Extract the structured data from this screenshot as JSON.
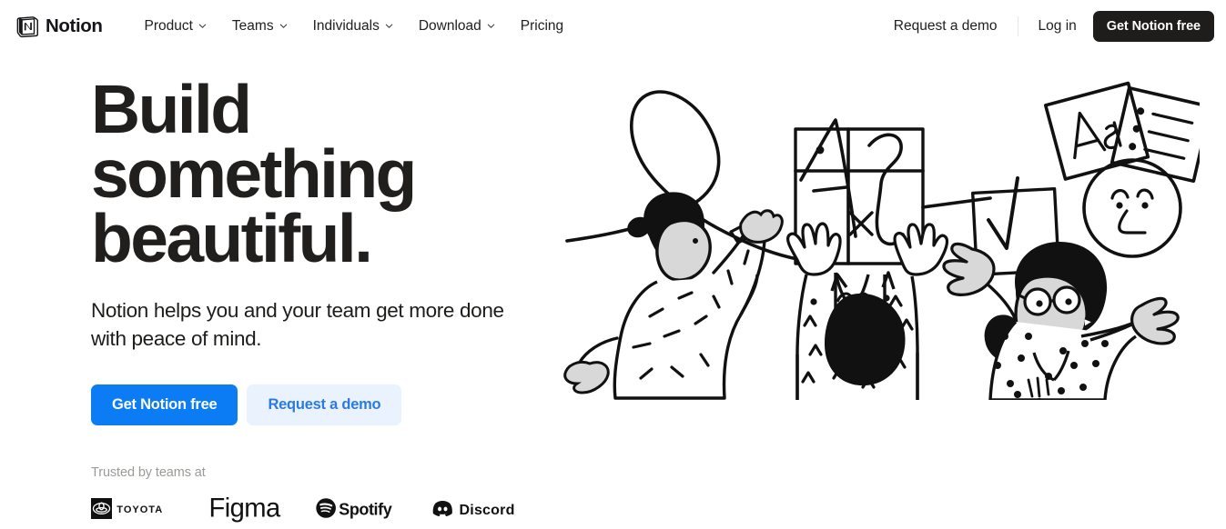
{
  "nav": {
    "brand": {
      "name": "Notion",
      "icon": "notion-logo-icon"
    },
    "links": [
      {
        "label": "Product",
        "has_chevron": true
      },
      {
        "label": "Teams",
        "has_chevron": true
      },
      {
        "label": "Individuals",
        "has_chevron": true
      },
      {
        "label": "Download",
        "has_chevron": true
      },
      {
        "label": "Pricing",
        "has_chevron": false
      }
    ],
    "request_demo": "Request a demo",
    "login": "Log in",
    "cta": "Get Notion free"
  },
  "hero": {
    "title_lines": [
      "Build",
      "something",
      "beautiful."
    ],
    "title_full": "Build something beautiful.",
    "subtitle": "Notion helps you and your team get more done with peace of mind.",
    "primary_cta": "Get Notion free",
    "secondary_cta": "Request a demo",
    "trusted_label": "Trusted by teams at",
    "logos": [
      {
        "name": "Toyota",
        "icon": "toyota-logo-icon"
      },
      {
        "name": "Figma",
        "icon": "figma-logo-icon"
      },
      {
        "name": "Spotify",
        "icon": "spotify-logo-icon"
      },
      {
        "name": "Discord",
        "icon": "discord-logo-icon"
      }
    ],
    "illustration": {
      "name": "people-holding-notion-blocks-illustration",
      "elements": [
        "squiggle-loop",
        "table-block",
        "multiply-sign",
        "integral-sign",
        "checkmark-card",
        "Aa-typography-card",
        "bulleted-list-card",
        "face-circle",
        "three-people"
      ]
    }
  },
  "colors": {
    "accent_blue": "#0b7cf3",
    "accent_blue_soft_bg": "#eaf2fd",
    "accent_blue_soft_text": "#2c7ae0",
    "dark": "#1e1d1b",
    "text": "#201f1e",
    "muted": "#9b9a97",
    "page_bg": "#ffffff"
  }
}
